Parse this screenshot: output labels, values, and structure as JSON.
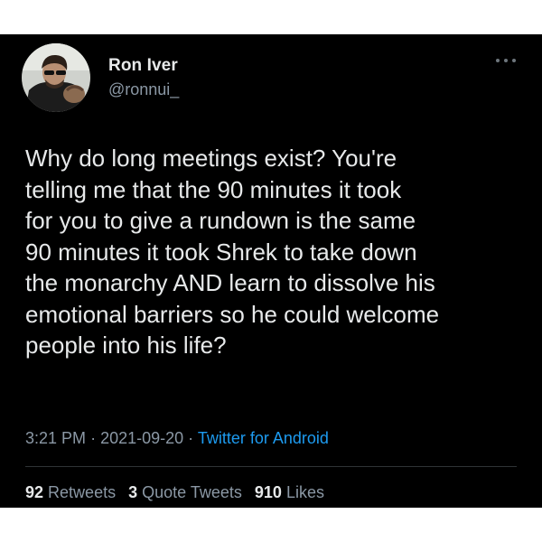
{
  "user": {
    "display_name": "Ron Iver",
    "handle": "@ronnui_"
  },
  "tweet": {
    "lines": [
      "Why do long meetings exist? You're",
      "telling me that the 90 minutes it took",
      "for you to give a rundown is the same",
      "90 minutes it took Shrek to take down",
      "the monarchy AND learn to dissolve his",
      "emotional barriers so he could welcome",
      "people into his life?"
    ],
    "time": "3:21 PM",
    "separator": "·",
    "date": "2021-09-20",
    "source": "Twitter for Android"
  },
  "stats": {
    "retweets_count": "92",
    "retweets_label": "Retweets",
    "quotes_count": "3",
    "quotes_label": "Quote Tweets",
    "likes_count": "910",
    "likes_label": "Likes"
  },
  "icons": {
    "more": "more-horizontal-icon"
  },
  "colors": {
    "background": "#000000",
    "text": "#e7e9ea",
    "secondary": "#8b98a5",
    "link": "#1d9bf0"
  }
}
